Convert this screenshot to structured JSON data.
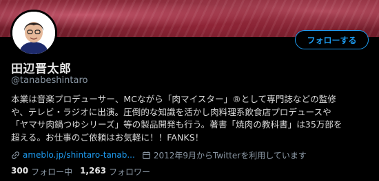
{
  "profile": {
    "name": "田辺晋太郎",
    "handle": "@tanabeshintaro",
    "follow_label": "フォローする",
    "bio": "本業は音楽プロデューサー、MCながら「肉マイスター」®として専門誌などの監修\nや、テレビ・ラジオに出演。圧倒的な知識を活かし肉料理系飲食店プロデュースや\n「ヤマサ肉鍋つゆシリーズ」等の製品開発も行う。著書「焼肉の教科書」は35万部を\n超える。お仕事のご依頼はお気軽に！！FANKS！",
    "link_text": "ameblo.jp/shintaro-tanab...",
    "joined": "2012年9月からTwitterを利用しています"
  },
  "stats": {
    "following_count": "300",
    "following_label": "フォロー中",
    "followers_count": "1,263",
    "followers_label": "フォロワー"
  },
  "icons": {
    "link": "link-icon",
    "calendar": "calendar-icon"
  },
  "colors": {
    "background": "#000000",
    "accent": "#1d9bf0",
    "secondary_text": "#8b98a5",
    "banner": "#8a2a3a"
  }
}
